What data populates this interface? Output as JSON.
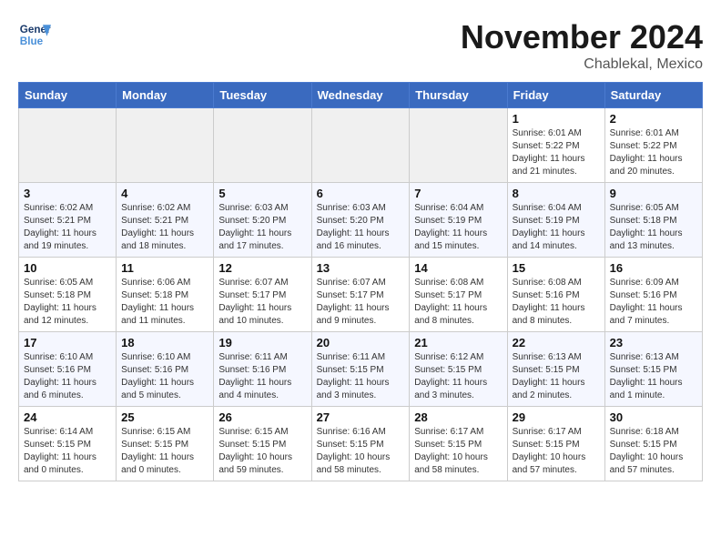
{
  "header": {
    "logo_line1": "General",
    "logo_line2": "Blue",
    "month": "November 2024",
    "location": "Chablekal, Mexico"
  },
  "weekdays": [
    "Sunday",
    "Monday",
    "Tuesday",
    "Wednesday",
    "Thursday",
    "Friday",
    "Saturday"
  ],
  "weeks": [
    [
      {
        "num": "",
        "detail": ""
      },
      {
        "num": "",
        "detail": ""
      },
      {
        "num": "",
        "detail": ""
      },
      {
        "num": "",
        "detail": ""
      },
      {
        "num": "",
        "detail": ""
      },
      {
        "num": "1",
        "detail": "Sunrise: 6:01 AM\nSunset: 5:22 PM\nDaylight: 11 hours\nand 21 minutes."
      },
      {
        "num": "2",
        "detail": "Sunrise: 6:01 AM\nSunset: 5:22 PM\nDaylight: 11 hours\nand 20 minutes."
      }
    ],
    [
      {
        "num": "3",
        "detail": "Sunrise: 6:02 AM\nSunset: 5:21 PM\nDaylight: 11 hours\nand 19 minutes."
      },
      {
        "num": "4",
        "detail": "Sunrise: 6:02 AM\nSunset: 5:21 PM\nDaylight: 11 hours\nand 18 minutes."
      },
      {
        "num": "5",
        "detail": "Sunrise: 6:03 AM\nSunset: 5:20 PM\nDaylight: 11 hours\nand 17 minutes."
      },
      {
        "num": "6",
        "detail": "Sunrise: 6:03 AM\nSunset: 5:20 PM\nDaylight: 11 hours\nand 16 minutes."
      },
      {
        "num": "7",
        "detail": "Sunrise: 6:04 AM\nSunset: 5:19 PM\nDaylight: 11 hours\nand 15 minutes."
      },
      {
        "num": "8",
        "detail": "Sunrise: 6:04 AM\nSunset: 5:19 PM\nDaylight: 11 hours\nand 14 minutes."
      },
      {
        "num": "9",
        "detail": "Sunrise: 6:05 AM\nSunset: 5:18 PM\nDaylight: 11 hours\nand 13 minutes."
      }
    ],
    [
      {
        "num": "10",
        "detail": "Sunrise: 6:05 AM\nSunset: 5:18 PM\nDaylight: 11 hours\nand 12 minutes."
      },
      {
        "num": "11",
        "detail": "Sunrise: 6:06 AM\nSunset: 5:18 PM\nDaylight: 11 hours\nand 11 minutes."
      },
      {
        "num": "12",
        "detail": "Sunrise: 6:07 AM\nSunset: 5:17 PM\nDaylight: 11 hours\nand 10 minutes."
      },
      {
        "num": "13",
        "detail": "Sunrise: 6:07 AM\nSunset: 5:17 PM\nDaylight: 11 hours\nand 9 minutes."
      },
      {
        "num": "14",
        "detail": "Sunrise: 6:08 AM\nSunset: 5:17 PM\nDaylight: 11 hours\nand 8 minutes."
      },
      {
        "num": "15",
        "detail": "Sunrise: 6:08 AM\nSunset: 5:16 PM\nDaylight: 11 hours\nand 8 minutes."
      },
      {
        "num": "16",
        "detail": "Sunrise: 6:09 AM\nSunset: 5:16 PM\nDaylight: 11 hours\nand 7 minutes."
      }
    ],
    [
      {
        "num": "17",
        "detail": "Sunrise: 6:10 AM\nSunset: 5:16 PM\nDaylight: 11 hours\nand 6 minutes."
      },
      {
        "num": "18",
        "detail": "Sunrise: 6:10 AM\nSunset: 5:16 PM\nDaylight: 11 hours\nand 5 minutes."
      },
      {
        "num": "19",
        "detail": "Sunrise: 6:11 AM\nSunset: 5:16 PM\nDaylight: 11 hours\nand 4 minutes."
      },
      {
        "num": "20",
        "detail": "Sunrise: 6:11 AM\nSunset: 5:15 PM\nDaylight: 11 hours\nand 3 minutes."
      },
      {
        "num": "21",
        "detail": "Sunrise: 6:12 AM\nSunset: 5:15 PM\nDaylight: 11 hours\nand 3 minutes."
      },
      {
        "num": "22",
        "detail": "Sunrise: 6:13 AM\nSunset: 5:15 PM\nDaylight: 11 hours\nand 2 minutes."
      },
      {
        "num": "23",
        "detail": "Sunrise: 6:13 AM\nSunset: 5:15 PM\nDaylight: 11 hours\nand 1 minute."
      }
    ],
    [
      {
        "num": "24",
        "detail": "Sunrise: 6:14 AM\nSunset: 5:15 PM\nDaylight: 11 hours\nand 0 minutes."
      },
      {
        "num": "25",
        "detail": "Sunrise: 6:15 AM\nSunset: 5:15 PM\nDaylight: 11 hours\nand 0 minutes."
      },
      {
        "num": "26",
        "detail": "Sunrise: 6:15 AM\nSunset: 5:15 PM\nDaylight: 10 hours\nand 59 minutes."
      },
      {
        "num": "27",
        "detail": "Sunrise: 6:16 AM\nSunset: 5:15 PM\nDaylight: 10 hours\nand 58 minutes."
      },
      {
        "num": "28",
        "detail": "Sunrise: 6:17 AM\nSunset: 5:15 PM\nDaylight: 10 hours\nand 58 minutes."
      },
      {
        "num": "29",
        "detail": "Sunrise: 6:17 AM\nSunset: 5:15 PM\nDaylight: 10 hours\nand 57 minutes."
      },
      {
        "num": "30",
        "detail": "Sunrise: 6:18 AM\nSunset: 5:15 PM\nDaylight: 10 hours\nand 57 minutes."
      }
    ]
  ]
}
